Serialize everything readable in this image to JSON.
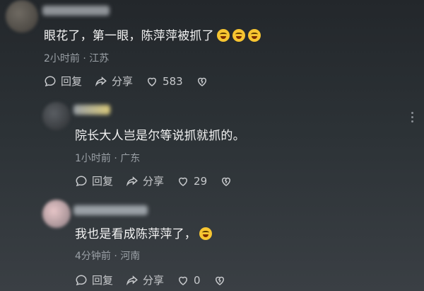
{
  "comments": [
    {
      "text": "眼花了，第一眼，陈萍萍被抓了",
      "emoji_count": 3,
      "meta": "2小时前 · 江苏",
      "reply_label": "回复",
      "share_label": "分享",
      "like_count": "583"
    },
    {
      "text": "院长大人岂是尔等说抓就抓的。",
      "meta": "1小时前 · 广东",
      "reply_label": "回复",
      "share_label": "分享",
      "like_count": "29"
    },
    {
      "text": "我也是看成陈萍萍了，",
      "emoji_count": 1,
      "meta": "4分钟前 · 河南",
      "reply_label": "回复",
      "share_label": "分享",
      "like_count": "0"
    }
  ],
  "colors": {
    "background": "#2c3236",
    "text": "#f3f3f3",
    "meta": "#9aa0a6",
    "emoji": "#f7c531"
  }
}
